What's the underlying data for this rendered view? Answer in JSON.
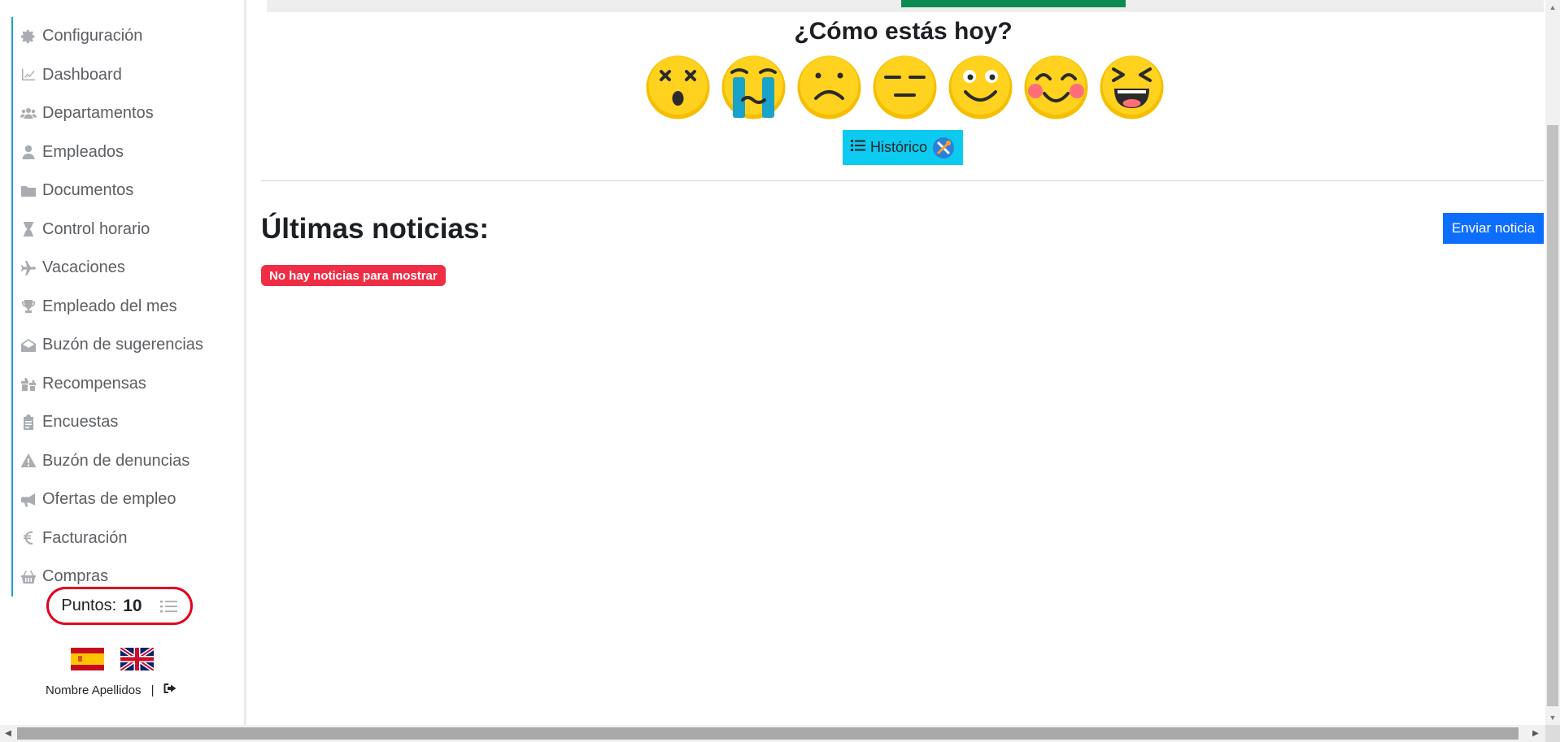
{
  "sidebar": {
    "items": [
      {
        "label": "Configuración",
        "icon": "gear-icon"
      },
      {
        "label": "Dashboard",
        "icon": "chart-line-icon"
      },
      {
        "label": "Departamentos",
        "icon": "users-icon"
      },
      {
        "label": "Empleados",
        "icon": "user-icon"
      },
      {
        "label": "Documentos",
        "icon": "folder-icon"
      },
      {
        "label": "Control horario",
        "icon": "hourglass-icon"
      },
      {
        "label": "Vacaciones",
        "icon": "plane-icon"
      },
      {
        "label": "Empleado del mes",
        "icon": "trophy-icon"
      },
      {
        "label": "Buzón de sugerencias",
        "icon": "envelope-open-icon"
      },
      {
        "label": "Recompensas",
        "icon": "gifts-icon"
      },
      {
        "label": "Encuestas",
        "icon": "clipboard-icon"
      },
      {
        "label": "Buzón de denuncias",
        "icon": "warning-icon"
      },
      {
        "label": "Ofertas de empleo",
        "icon": "megaphone-icon"
      },
      {
        "label": "Facturación",
        "icon": "euro-icon"
      },
      {
        "label": "Compras",
        "icon": "basket-icon"
      }
    ],
    "points_label": "Puntos:",
    "points_value": "10",
    "user_name": "Nombre Apellidos",
    "separator": "|"
  },
  "main": {
    "mood_title": "¿Cómo estás hoy?",
    "emojis": [
      "dizzy-face-icon",
      "crying-face-icon",
      "sad-face-icon",
      "neutral-face-icon",
      "smiling-face-icon",
      "blushing-face-icon",
      "laughing-face-icon"
    ],
    "history_label": "Histórico",
    "news_title": "Últimas noticias:",
    "send_news_label": "Enviar noticia",
    "no_news_label": "No hay noticias para mostrar"
  },
  "colors": {
    "accent_cyan": "#0dcaf0",
    "primary_blue": "#0d6efd",
    "danger_red": "#ef2d44",
    "sidebar_border": "#1fa2c8",
    "highlight_ring": "#e3001b",
    "top_green": "#0b8a51"
  }
}
